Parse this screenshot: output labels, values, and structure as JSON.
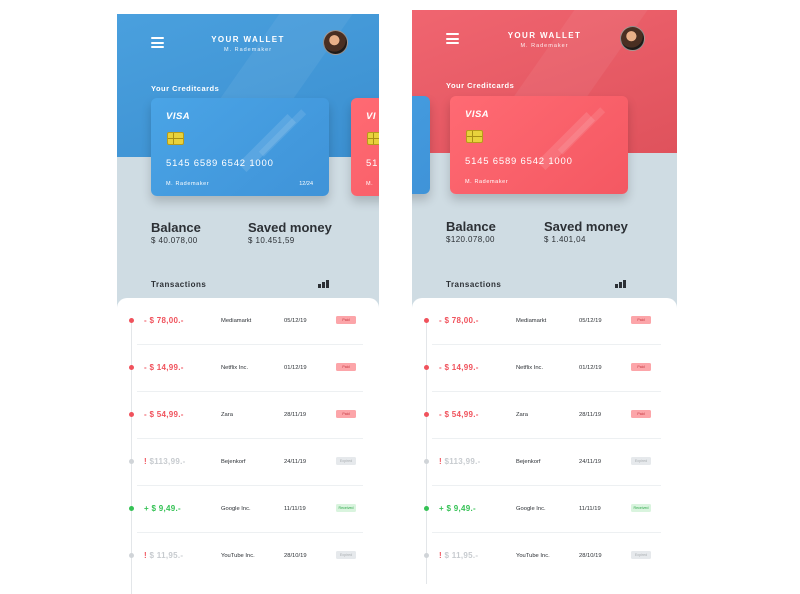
{
  "app": {
    "title": "YOUR WALLET",
    "user": "M. Rademaker"
  },
  "cards_label": "Your Creditcards",
  "card": {
    "brand": "VISA",
    "number": "5145 6589 6542 1000",
    "holder": "M. Rademaker",
    "expiry": "12/24",
    "brand_short": "VI",
    "number_short": "51",
    "holder_short": "M."
  },
  "stats_labels": {
    "balance": "Balance",
    "saved": "Saved money"
  },
  "blue": {
    "balance": "$ 40.078,00",
    "saved": "$ 10.451,59"
  },
  "red": {
    "balance": "$120.078,00",
    "saved": "$  1.401,04"
  },
  "transactions_label": "Transactions",
  "transactions": [
    {
      "amount": "- $ 78,00.-",
      "merchant": "Mediamarkt",
      "date": "05/12/19",
      "status": "Paid"
    },
    {
      "amount": "- $ 14,99.-",
      "merchant": "Netflix Inc.",
      "date": "01/12/19",
      "status": "Paid"
    },
    {
      "amount": "- $ 54,99.-",
      "merchant": "Zara",
      "date": "28/11/19",
      "status": "Paid"
    },
    {
      "amount": "$113,99.-",
      "merchant": "Bejenkorf",
      "date": "24/11/19",
      "status": "Expired"
    },
    {
      "amount": "+ $   9,49.-",
      "merchant": "Google Inc.",
      "date": "11/11/19",
      "status": "Received"
    },
    {
      "amount": "$ 11,95.-",
      "merchant": "YouTube Inc.",
      "date": "28/10/19",
      "status": "Expired"
    }
  ],
  "icons": {
    "menu": "hamburger-menu-icon",
    "avatar": "user-avatar",
    "chart": "bar-chart-icon"
  },
  "colors": {
    "blue_accent": "#3f93d8",
    "red_accent": "#f45862",
    "paid": "#f0525c",
    "received": "#35c255",
    "expired": "#c7cbcf"
  }
}
